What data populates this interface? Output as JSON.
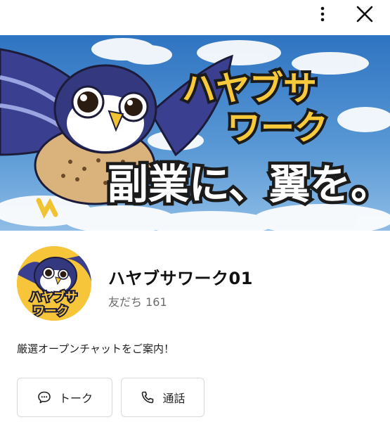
{
  "header": {
    "more_icon": "more-vertical-icon",
    "close_icon": "close-icon"
  },
  "banner": {
    "line1": "ハヤブサ",
    "line2": "ワーク",
    "tagline": "副業に、翼を。"
  },
  "avatar": {
    "line1": "ハヤブサ",
    "line2": "ワーク"
  },
  "profile": {
    "name": "ハヤブサワーク01",
    "friends_label": "友だち",
    "friends_count": "161",
    "description": "厳選オープンチャットをご案内！"
  },
  "actions": {
    "talk_label": "トーク",
    "call_label": "通話"
  },
  "colors": {
    "sky": "#3e82c9",
    "logo_yellow": "#f8c93a",
    "bird_navy": "#2f2f7a"
  }
}
